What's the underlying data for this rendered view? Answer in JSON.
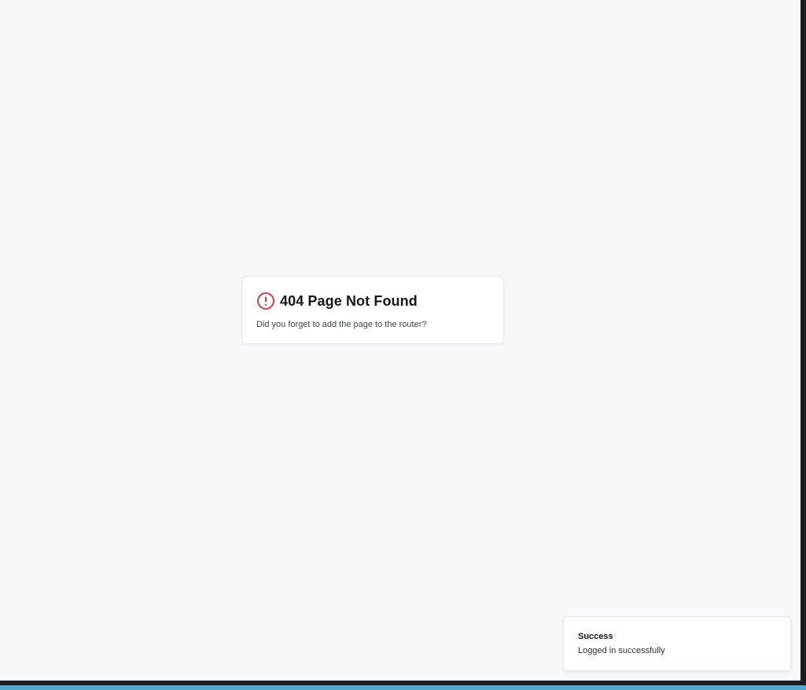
{
  "not_found": {
    "icon": "alert-circle-icon",
    "title": "404 Page Not Found",
    "message": "Did you forget to add the page to the router?",
    "icon_color": "#dc3c3c"
  },
  "toast": {
    "title": "Success",
    "message": "Logged in successfully"
  },
  "colors": {
    "background": "#f7f8fa",
    "taskbar_accent": "#4fa9cf",
    "frame": "#1a1c22"
  }
}
